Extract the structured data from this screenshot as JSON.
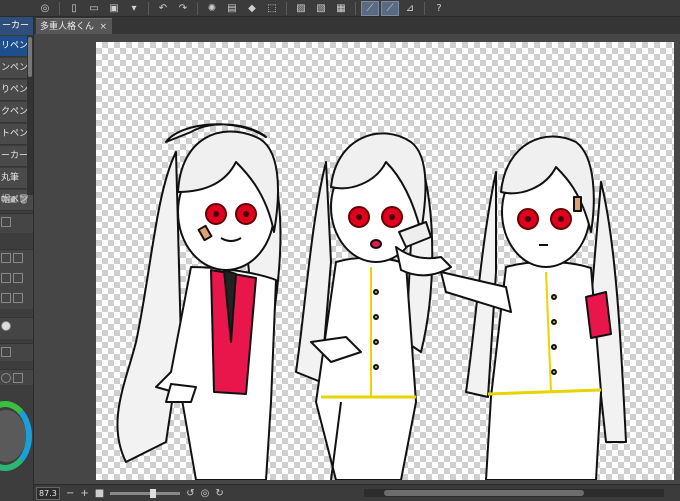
{
  "document": {
    "tab_title": "多重人格くん",
    "close_glyph": "×"
  },
  "subtool": {
    "header": "ーカー",
    "items": [
      {
        "label": "リペン",
        "selected": true
      },
      {
        "label": "ンペン",
        "selected": false
      },
      {
        "label": "りペン",
        "selected": false
      },
      {
        "label": "クペン",
        "selected": false
      },
      {
        "label": "トペン",
        "selected": false
      },
      {
        "label": "ーカー",
        "selected": false
      },
      {
        "label": "丸筆",
        "selected": false
      },
      {
        "label": "帽ペン",
        "selected": false
      }
    ]
  },
  "status": {
    "zoom": "87.3"
  },
  "colors": {
    "accent": "#1e4f8c",
    "red": "#e8164a",
    "eyes": "#e00020",
    "trim": "#e6d500"
  }
}
